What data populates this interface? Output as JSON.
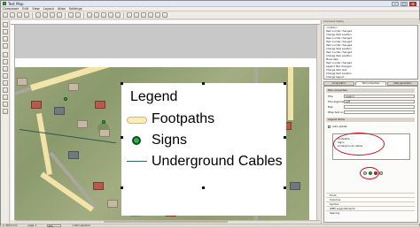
{
  "window": {
    "title": "Test Map"
  },
  "menu": [
    "Composer",
    "Edit",
    "View",
    "Layout",
    "Atlas",
    "Settings"
  ],
  "undo_history": {
    "items": [
      "<empty>",
      "Item z-order changed",
      "Change item position",
      "Item z-order changed",
      "Item z-order changed",
      "Item z-order changed",
      "Change item position",
      "Item z-order changed",
      "Change item position",
      "Move item",
      "Item z-order changed",
      "Legend title changed",
      "Change item size",
      "Change item position",
      "Change legend"
    ]
  },
  "tabs": [
    "Composition",
    "Item properties",
    "Atlas generation"
  ],
  "properties": {
    "header": "Main properties",
    "title_label": "Title",
    "title_value": "Legend",
    "title_alignment_label": "Title alignment",
    "title_alignment_value": "Left",
    "map_label": "Map",
    "wrap_label": "Wrap text on",
    "legend_items_header": "Legend items",
    "auto_update_label": "Auto update",
    "legend_entries": [
      "Footpaths",
      "Signs",
      "Underground cables"
    ],
    "sections": [
      "Fonts",
      "Columns",
      "Symbol",
      "WMS LegendGraphic",
      "Spacing"
    ]
  },
  "legend": {
    "title": "Legend",
    "items": [
      "Footpaths",
      "Signs",
      "Underground Cables"
    ]
  },
  "status": {
    "coords": "x: 245.0 mm",
    "page": "page: 1",
    "zoom": "45%",
    "selection": "1 item selected"
  }
}
